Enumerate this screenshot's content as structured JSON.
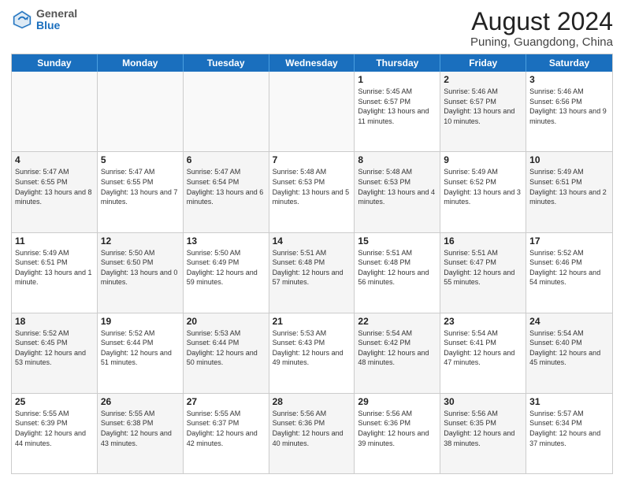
{
  "logo": {
    "general": "General",
    "blue": "Blue"
  },
  "header": {
    "month_year": "August 2024",
    "location": "Puning, Guangdong, China"
  },
  "weekdays": [
    "Sunday",
    "Monday",
    "Tuesday",
    "Wednesday",
    "Thursday",
    "Friday",
    "Saturday"
  ],
  "rows": [
    [
      {
        "day": "",
        "text": "",
        "empty": true
      },
      {
        "day": "",
        "text": "",
        "empty": true
      },
      {
        "day": "",
        "text": "",
        "empty": true
      },
      {
        "day": "",
        "text": "",
        "empty": true
      },
      {
        "day": "1",
        "text": "Sunrise: 5:45 AM\nSunset: 6:57 PM\nDaylight: 13 hours and 11 minutes."
      },
      {
        "day": "2",
        "text": "Sunrise: 5:46 AM\nSunset: 6:57 PM\nDaylight: 13 hours and 10 minutes.",
        "shade": true
      },
      {
        "day": "3",
        "text": "Sunrise: 5:46 AM\nSunset: 6:56 PM\nDaylight: 13 hours and 9 minutes."
      }
    ],
    [
      {
        "day": "4",
        "text": "Sunrise: 5:47 AM\nSunset: 6:55 PM\nDaylight: 13 hours and 8 minutes.",
        "shade": true
      },
      {
        "day": "5",
        "text": "Sunrise: 5:47 AM\nSunset: 6:55 PM\nDaylight: 13 hours and 7 minutes."
      },
      {
        "day": "6",
        "text": "Sunrise: 5:47 AM\nSunset: 6:54 PM\nDaylight: 13 hours and 6 minutes.",
        "shade": true
      },
      {
        "day": "7",
        "text": "Sunrise: 5:48 AM\nSunset: 6:53 PM\nDaylight: 13 hours and 5 minutes."
      },
      {
        "day": "8",
        "text": "Sunrise: 5:48 AM\nSunset: 6:53 PM\nDaylight: 13 hours and 4 minutes.",
        "shade": true
      },
      {
        "day": "9",
        "text": "Sunrise: 5:49 AM\nSunset: 6:52 PM\nDaylight: 13 hours and 3 minutes."
      },
      {
        "day": "10",
        "text": "Sunrise: 5:49 AM\nSunset: 6:51 PM\nDaylight: 13 hours and 2 minutes.",
        "shade": true
      }
    ],
    [
      {
        "day": "11",
        "text": "Sunrise: 5:49 AM\nSunset: 6:51 PM\nDaylight: 13 hours and 1 minute."
      },
      {
        "day": "12",
        "text": "Sunrise: 5:50 AM\nSunset: 6:50 PM\nDaylight: 13 hours and 0 minutes.",
        "shade": true
      },
      {
        "day": "13",
        "text": "Sunrise: 5:50 AM\nSunset: 6:49 PM\nDaylight: 12 hours and 59 minutes."
      },
      {
        "day": "14",
        "text": "Sunrise: 5:51 AM\nSunset: 6:48 PM\nDaylight: 12 hours and 57 minutes.",
        "shade": true
      },
      {
        "day": "15",
        "text": "Sunrise: 5:51 AM\nSunset: 6:48 PM\nDaylight: 12 hours and 56 minutes."
      },
      {
        "day": "16",
        "text": "Sunrise: 5:51 AM\nSunset: 6:47 PM\nDaylight: 12 hours and 55 minutes.",
        "shade": true
      },
      {
        "day": "17",
        "text": "Sunrise: 5:52 AM\nSunset: 6:46 PM\nDaylight: 12 hours and 54 minutes."
      }
    ],
    [
      {
        "day": "18",
        "text": "Sunrise: 5:52 AM\nSunset: 6:45 PM\nDaylight: 12 hours and 53 minutes.",
        "shade": true
      },
      {
        "day": "19",
        "text": "Sunrise: 5:52 AM\nSunset: 6:44 PM\nDaylight: 12 hours and 51 minutes."
      },
      {
        "day": "20",
        "text": "Sunrise: 5:53 AM\nSunset: 6:44 PM\nDaylight: 12 hours and 50 minutes.",
        "shade": true
      },
      {
        "day": "21",
        "text": "Sunrise: 5:53 AM\nSunset: 6:43 PM\nDaylight: 12 hours and 49 minutes."
      },
      {
        "day": "22",
        "text": "Sunrise: 5:54 AM\nSunset: 6:42 PM\nDaylight: 12 hours and 48 minutes.",
        "shade": true
      },
      {
        "day": "23",
        "text": "Sunrise: 5:54 AM\nSunset: 6:41 PM\nDaylight: 12 hours and 47 minutes."
      },
      {
        "day": "24",
        "text": "Sunrise: 5:54 AM\nSunset: 6:40 PM\nDaylight: 12 hours and 45 minutes.",
        "shade": true
      }
    ],
    [
      {
        "day": "25",
        "text": "Sunrise: 5:55 AM\nSunset: 6:39 PM\nDaylight: 12 hours and 44 minutes."
      },
      {
        "day": "26",
        "text": "Sunrise: 5:55 AM\nSunset: 6:38 PM\nDaylight: 12 hours and 43 minutes.",
        "shade": true
      },
      {
        "day": "27",
        "text": "Sunrise: 5:55 AM\nSunset: 6:37 PM\nDaylight: 12 hours and 42 minutes."
      },
      {
        "day": "28",
        "text": "Sunrise: 5:56 AM\nSunset: 6:36 PM\nDaylight: 12 hours and 40 minutes.",
        "shade": true
      },
      {
        "day": "29",
        "text": "Sunrise: 5:56 AM\nSunset: 6:36 PM\nDaylight: 12 hours and 39 minutes."
      },
      {
        "day": "30",
        "text": "Sunrise: 5:56 AM\nSunset: 6:35 PM\nDaylight: 12 hours and 38 minutes.",
        "shade": true
      },
      {
        "day": "31",
        "text": "Sunrise: 5:57 AM\nSunset: 6:34 PM\nDaylight: 12 hours and 37 minutes."
      }
    ]
  ]
}
